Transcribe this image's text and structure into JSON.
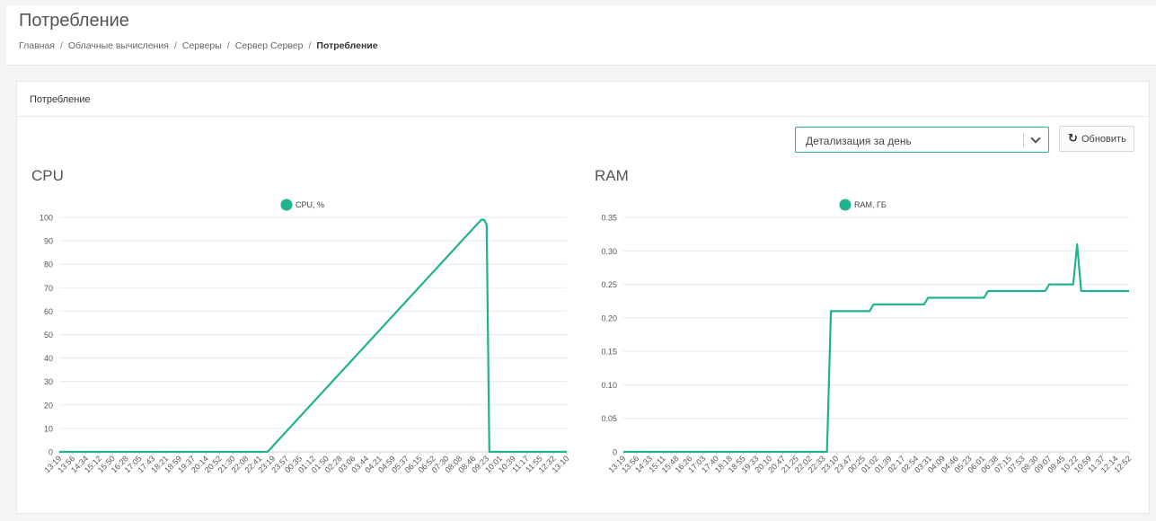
{
  "header": {
    "title": "Потребление",
    "breadcrumb": [
      "Главная",
      "Облачные вычисления",
      "Серверы",
      "Сервер Сервер",
      "Потребление"
    ],
    "separator": "/"
  },
  "card": {
    "title": "Потребление"
  },
  "controls": {
    "detail_select": "Детализация за день",
    "refresh_label": "Обновить"
  },
  "colors": {
    "accent": "#2bb395",
    "line": "#21b290"
  },
  "chart_data": [
    {
      "type": "line",
      "title": "CPU",
      "ylim": [
        0,
        100
      ],
      "y_ticks": [
        "0",
        "10",
        "20",
        "30",
        "40",
        "50",
        "60",
        "70",
        "80",
        "90",
        "100"
      ],
      "x_ticks": [
        "13:19",
        "13:56",
        "14:34",
        "15:12",
        "15:50",
        "16:28",
        "17:05",
        "17:43",
        "18:21",
        "18:59",
        "19:37",
        "20:14",
        "20:52",
        "21:30",
        "22:08",
        "22:41",
        "23:19",
        "23:57",
        "00:35",
        "01:12",
        "01:50",
        "02:28",
        "03:06",
        "03:44",
        "04:21",
        "04:59",
        "05:37",
        "06:15",
        "06:52",
        "07:30",
        "08:08",
        "08:46",
        "09:23",
        "10:01",
        "10:39",
        "11:17",
        "11:55",
        "12:32",
        "13:10"
      ],
      "series": [
        {
          "name": "CPU, %",
          "points": [
            [
              0,
              0
            ],
            [
              15.6,
              0
            ],
            [
              31.6,
              99
            ],
            [
              31.8,
              99
            ],
            [
              32,
              97
            ],
            [
              32.2,
              0
            ],
            [
              38,
              0
            ]
          ]
        }
      ],
      "grid": true,
      "legend": "top-center"
    },
    {
      "type": "line",
      "title": "RAM",
      "ylim": [
        0,
        0.35
      ],
      "y_ticks": [
        "0",
        "0.05",
        "0.10",
        "0.15",
        "0.20",
        "0.25",
        "0.30",
        "0.35"
      ],
      "x_ticks": [
        "13:19",
        "13:56",
        "14:33",
        "15:11",
        "15:48",
        "16:26",
        "17:03",
        "17:40",
        "18:18",
        "18:55",
        "19:33",
        "20:10",
        "20:47",
        "21:25",
        "22:02",
        "22:33",
        "23:10",
        "23:47",
        "00:25",
        "01:02",
        "01:39",
        "02:17",
        "02:54",
        "03:31",
        "04:09",
        "04:46",
        "05:23",
        "06:01",
        "06:38",
        "07:15",
        "07:53",
        "08:30",
        "09:07",
        "09:45",
        "10:22",
        "10:59",
        "11:37",
        "12:14",
        "12:52"
      ],
      "series": [
        {
          "name": "RAM, ГБ",
          "points": [
            [
              0,
              0
            ],
            [
              15.3,
              0
            ],
            [
              15.6,
              0.21
            ],
            [
              18.5,
              0.21
            ],
            [
              18.8,
              0.22
            ],
            [
              22.6,
              0.22
            ],
            [
              22.9,
              0.23
            ],
            [
              27.1,
              0.23
            ],
            [
              27.4,
              0.24
            ],
            [
              31.7,
              0.24
            ],
            [
              32,
              0.25
            ],
            [
              33.8,
              0.25
            ],
            [
              34.1,
              0.31
            ],
            [
              34.4,
              0.24
            ],
            [
              38,
              0.24
            ]
          ]
        }
      ],
      "grid": true,
      "legend": "top-center"
    }
  ]
}
